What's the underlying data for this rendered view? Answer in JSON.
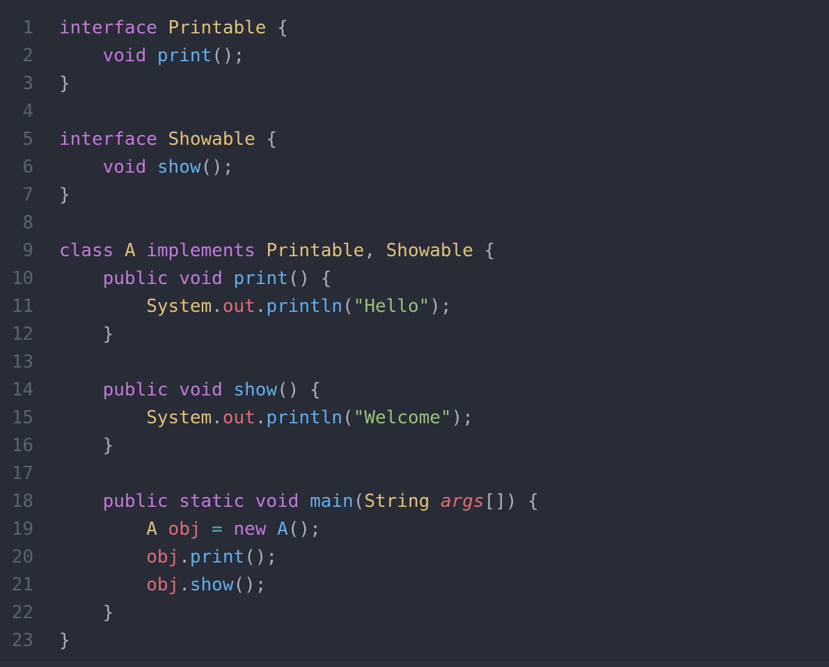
{
  "editor": {
    "language": "java",
    "theme": "one-dark",
    "background_color": "#282c36",
    "gutter_color": "#5c6370",
    "default_text_color": "#abb2bf",
    "total_lines": 23,
    "tab_size": 4,
    "token_colors": {
      "keyword": "#c678dd",
      "type": "#e5c07b",
      "function": "#61afef",
      "string": "#98c379",
      "variable": "#e06c75",
      "parameter": "#e06c75",
      "property": "#e06c75",
      "operator": "#56b6c2",
      "punctuation": "#abb2bf"
    }
  },
  "lines": [
    {
      "number": "1",
      "text": "interface Printable {",
      "indent": 0,
      "tokens": [
        {
          "t": "interface",
          "c": "keyword"
        },
        {
          "t": " ",
          "c": "plain"
        },
        {
          "t": "Printable",
          "c": "type"
        },
        {
          "t": " ",
          "c": "plain"
        },
        {
          "t": "{",
          "c": "punct"
        }
      ]
    },
    {
      "number": "2",
      "text": "    void print();",
      "indent": 1,
      "tokens": [
        {
          "t": "    ",
          "c": "plain"
        },
        {
          "t": "void",
          "c": "keyword"
        },
        {
          "t": " ",
          "c": "plain"
        },
        {
          "t": "print",
          "c": "function"
        },
        {
          "t": "();",
          "c": "punct"
        }
      ]
    },
    {
      "number": "3",
      "text": "}",
      "indent": 0,
      "tokens": [
        {
          "t": "}",
          "c": "punct"
        }
      ]
    },
    {
      "number": "4",
      "text": "",
      "indent": 0,
      "tokens": []
    },
    {
      "number": "5",
      "text": "interface Showable {",
      "indent": 0,
      "tokens": [
        {
          "t": "interface",
          "c": "keyword"
        },
        {
          "t": " ",
          "c": "plain"
        },
        {
          "t": "Showable",
          "c": "type"
        },
        {
          "t": " ",
          "c": "plain"
        },
        {
          "t": "{",
          "c": "punct"
        }
      ]
    },
    {
      "number": "6",
      "text": "    void show();",
      "indent": 1,
      "tokens": [
        {
          "t": "    ",
          "c": "plain"
        },
        {
          "t": "void",
          "c": "keyword"
        },
        {
          "t": " ",
          "c": "plain"
        },
        {
          "t": "show",
          "c": "function"
        },
        {
          "t": "();",
          "c": "punct"
        }
      ]
    },
    {
      "number": "7",
      "text": "}",
      "indent": 0,
      "tokens": [
        {
          "t": "}",
          "c": "punct"
        }
      ]
    },
    {
      "number": "8",
      "text": "",
      "indent": 0,
      "tokens": []
    },
    {
      "number": "9",
      "text": "class A implements Printable, Showable {",
      "indent": 0,
      "tokens": [
        {
          "t": "class",
          "c": "keyword"
        },
        {
          "t": " ",
          "c": "plain"
        },
        {
          "t": "A",
          "c": "type"
        },
        {
          "t": " ",
          "c": "plain"
        },
        {
          "t": "implements",
          "c": "keyword"
        },
        {
          "t": " ",
          "c": "plain"
        },
        {
          "t": "Printable",
          "c": "type"
        },
        {
          "t": ", ",
          "c": "punct"
        },
        {
          "t": "Showable",
          "c": "type"
        },
        {
          "t": " ",
          "c": "plain"
        },
        {
          "t": "{",
          "c": "punct"
        }
      ]
    },
    {
      "number": "10",
      "text": "    public void print() {",
      "indent": 1,
      "tokens": [
        {
          "t": "    ",
          "c": "plain"
        },
        {
          "t": "public",
          "c": "keyword"
        },
        {
          "t": " ",
          "c": "plain"
        },
        {
          "t": "void",
          "c": "keyword"
        },
        {
          "t": " ",
          "c": "plain"
        },
        {
          "t": "print",
          "c": "function"
        },
        {
          "t": "() ",
          "c": "punct"
        },
        {
          "t": "{",
          "c": "punct"
        }
      ]
    },
    {
      "number": "11",
      "text": "        System.out.println(\"Hello\");",
      "indent": 2,
      "tokens": [
        {
          "t": "        ",
          "c": "plain"
        },
        {
          "t": "System",
          "c": "type"
        },
        {
          "t": ".",
          "c": "punct"
        },
        {
          "t": "out",
          "c": "property"
        },
        {
          "t": ".",
          "c": "punct"
        },
        {
          "t": "println",
          "c": "function"
        },
        {
          "t": "(",
          "c": "punct"
        },
        {
          "t": "\"Hello\"",
          "c": "string"
        },
        {
          "t": ");",
          "c": "punct"
        }
      ]
    },
    {
      "number": "12",
      "text": "    }",
      "indent": 1,
      "tokens": [
        {
          "t": "    ",
          "c": "plain"
        },
        {
          "t": "}",
          "c": "punct"
        }
      ]
    },
    {
      "number": "13",
      "text": "",
      "indent": 0,
      "tokens": []
    },
    {
      "number": "14",
      "text": "    public void show() {",
      "indent": 1,
      "tokens": [
        {
          "t": "    ",
          "c": "plain"
        },
        {
          "t": "public",
          "c": "keyword"
        },
        {
          "t": " ",
          "c": "plain"
        },
        {
          "t": "void",
          "c": "keyword"
        },
        {
          "t": " ",
          "c": "plain"
        },
        {
          "t": "show",
          "c": "function"
        },
        {
          "t": "() ",
          "c": "punct"
        },
        {
          "t": "{",
          "c": "punct"
        }
      ]
    },
    {
      "number": "15",
      "text": "        System.out.println(\"Welcome\");",
      "indent": 2,
      "tokens": [
        {
          "t": "        ",
          "c": "plain"
        },
        {
          "t": "System",
          "c": "type"
        },
        {
          "t": ".",
          "c": "punct"
        },
        {
          "t": "out",
          "c": "property"
        },
        {
          "t": ".",
          "c": "punct"
        },
        {
          "t": "println",
          "c": "function"
        },
        {
          "t": "(",
          "c": "punct"
        },
        {
          "t": "\"Welcome\"",
          "c": "string"
        },
        {
          "t": ");",
          "c": "punct"
        }
      ]
    },
    {
      "number": "16",
      "text": "    }",
      "indent": 1,
      "tokens": [
        {
          "t": "    ",
          "c": "plain"
        },
        {
          "t": "}",
          "c": "punct"
        }
      ]
    },
    {
      "number": "17",
      "text": "",
      "indent": 0,
      "tokens": []
    },
    {
      "number": "18",
      "text": "    public static void main(String args[]) {",
      "indent": 1,
      "tokens": [
        {
          "t": "    ",
          "c": "plain"
        },
        {
          "t": "public",
          "c": "keyword"
        },
        {
          "t": " ",
          "c": "plain"
        },
        {
          "t": "static",
          "c": "keyword"
        },
        {
          "t": " ",
          "c": "plain"
        },
        {
          "t": "void",
          "c": "keyword"
        },
        {
          "t": " ",
          "c": "plain"
        },
        {
          "t": "main",
          "c": "function"
        },
        {
          "t": "(",
          "c": "punct"
        },
        {
          "t": "String",
          "c": "type"
        },
        {
          "t": " ",
          "c": "plain"
        },
        {
          "t": "args",
          "c": "param"
        },
        {
          "t": "[]) ",
          "c": "punct"
        },
        {
          "t": "{",
          "c": "punct"
        }
      ]
    },
    {
      "number": "19",
      "text": "        A obj = new A();",
      "indent": 2,
      "tokens": [
        {
          "t": "        ",
          "c": "plain"
        },
        {
          "t": "A",
          "c": "type"
        },
        {
          "t": " ",
          "c": "plain"
        },
        {
          "t": "obj",
          "c": "variable"
        },
        {
          "t": " ",
          "c": "plain"
        },
        {
          "t": "=",
          "c": "operator"
        },
        {
          "t": " ",
          "c": "plain"
        },
        {
          "t": "new",
          "c": "keyword"
        },
        {
          "t": " ",
          "c": "plain"
        },
        {
          "t": "A",
          "c": "function"
        },
        {
          "t": "();",
          "c": "punct"
        }
      ]
    },
    {
      "number": "20",
      "text": "        obj.print();",
      "indent": 2,
      "tokens": [
        {
          "t": "        ",
          "c": "plain"
        },
        {
          "t": "obj",
          "c": "variable"
        },
        {
          "t": ".",
          "c": "punct"
        },
        {
          "t": "print",
          "c": "function"
        },
        {
          "t": "();",
          "c": "punct"
        }
      ]
    },
    {
      "number": "21",
      "text": "        obj.show();",
      "indent": 2,
      "tokens": [
        {
          "t": "        ",
          "c": "plain"
        },
        {
          "t": "obj",
          "c": "variable"
        },
        {
          "t": ".",
          "c": "punct"
        },
        {
          "t": "show",
          "c": "function"
        },
        {
          "t": "();",
          "c": "punct"
        }
      ]
    },
    {
      "number": "22",
      "text": "    }",
      "indent": 1,
      "tokens": [
        {
          "t": "    ",
          "c": "plain"
        },
        {
          "t": "}",
          "c": "punct"
        }
      ]
    },
    {
      "number": "23",
      "text": "}",
      "indent": 0,
      "tokens": [
        {
          "t": "}",
          "c": "punct"
        }
      ]
    }
  ]
}
